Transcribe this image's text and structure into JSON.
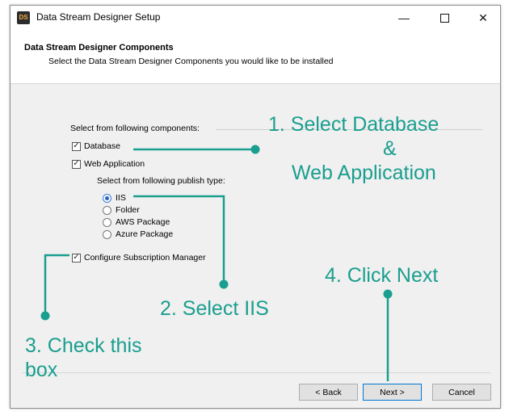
{
  "window": {
    "title": "Data Stream Designer Setup",
    "icon_text": "DS",
    "controls": {
      "minimize": "—",
      "maximize": "",
      "close": "✕"
    }
  },
  "header": {
    "title": "Data Stream Designer Components",
    "subtitle": "Select the Data Stream Designer Components you would like to be installed"
  },
  "components": {
    "label": "Select from following components:",
    "database": {
      "label": "Database",
      "checked": true
    },
    "web_application": {
      "label": "Web Application",
      "checked": true
    },
    "publish_label": "Select from following publish type:",
    "publish_types": [
      {
        "label": "IIS",
        "selected": true
      },
      {
        "label": "Folder",
        "selected": false
      },
      {
        "label": "AWS Package",
        "selected": false
      },
      {
        "label": "Azure Package",
        "selected": false
      }
    ],
    "subscription_manager": {
      "label": "Configure Subscription Manager",
      "checked": true
    }
  },
  "buttons": {
    "back": "< Back",
    "next": "Next >",
    "cancel": "Cancel"
  },
  "annotations": {
    "step1_line1": "1. Select Database",
    "step1_line2": "&",
    "step1_line3": "Web Application",
    "step2": "2. Select IIS",
    "step3_line1": "3. Check this",
    "step3_line2": "box",
    "step4": "4. Click Next"
  },
  "colors": {
    "annotation": "#1a9e8f",
    "focus_border": "#0078d7"
  }
}
